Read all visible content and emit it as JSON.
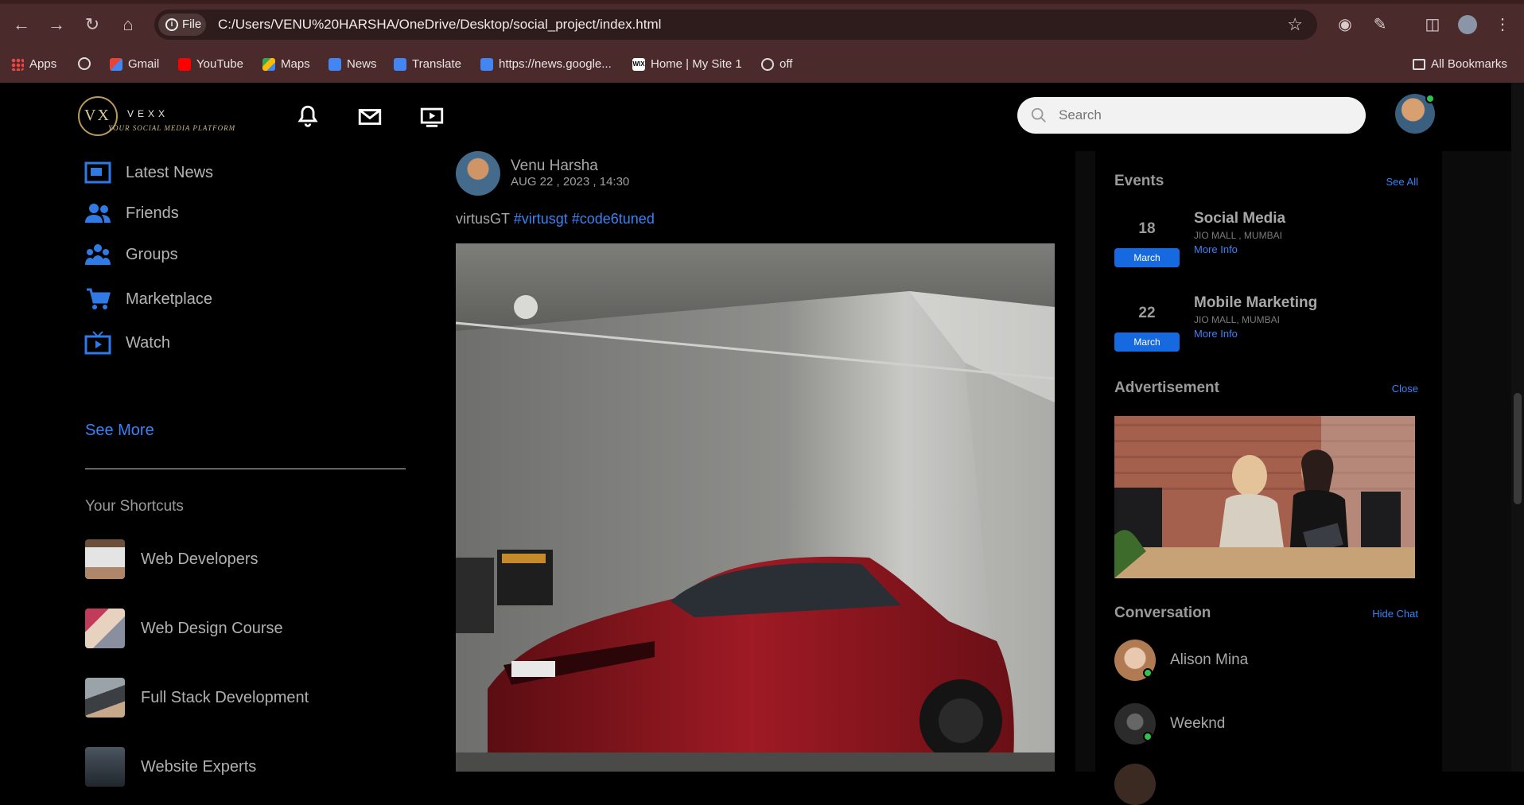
{
  "browser": {
    "file_chip": "File",
    "url": "C:/Users/VENU%20HARSHA/OneDrive/Desktop/social_project/index.html",
    "bookmarks": [
      {
        "label": "Apps",
        "icon": "apps-grid-icon"
      },
      {
        "label": "",
        "icon": "globe-icon"
      },
      {
        "label": "Gmail",
        "icon": "gmail-icon"
      },
      {
        "label": "YouTube",
        "icon": "youtube-icon"
      },
      {
        "label": "Maps",
        "icon": "maps-icon"
      },
      {
        "label": "News",
        "icon": "news-icon"
      },
      {
        "label": "Translate",
        "icon": "translate-icon"
      },
      {
        "label": "https://news.google...",
        "icon": "news-icon"
      },
      {
        "label": "Home | My Site 1",
        "icon": "wix-icon"
      },
      {
        "label": "off",
        "icon": "globe-icon"
      }
    ],
    "all_bookmarks": "All Bookmarks"
  },
  "header": {
    "logo_mark": "VX",
    "logo_name": "VEXX",
    "logo_tagline": "YOUR SOCIAL MEDIA PLATFORM",
    "search_placeholder": "Search"
  },
  "sidebar": {
    "items": [
      {
        "label": "Latest News",
        "icon": "news-icon"
      },
      {
        "label": "Friends",
        "icon": "friends-icon"
      },
      {
        "label": "Groups",
        "icon": "groups-icon"
      },
      {
        "label": "Marketplace",
        "icon": "cart-icon"
      },
      {
        "label": "Watch",
        "icon": "tv-icon"
      }
    ],
    "see_more": "See More",
    "shortcuts_title": "Your Shortcuts",
    "shortcuts": [
      {
        "label": "Web Developers"
      },
      {
        "label": "Web Design Course"
      },
      {
        "label": "Full Stack Development"
      },
      {
        "label": "Website Experts"
      }
    ]
  },
  "post": {
    "author": "Venu Harsha",
    "time": "AUG 22 , 2023 , 14:30",
    "text": "virtusGT",
    "tags": "#virtusgt #code6tuned"
  },
  "events": {
    "title": "Events",
    "see_all": "See All",
    "items": [
      {
        "day": "18",
        "month": "March",
        "name": "Social Media",
        "location": "JIO MALL , MUMBAI",
        "more": "More Info"
      },
      {
        "day": "22",
        "month": "March",
        "name": "Mobile Marketing",
        "location": "JIO MALL, MUMBAI",
        "more": "More Info"
      }
    ]
  },
  "advertisement": {
    "title": "Advertisement",
    "close": "Close"
  },
  "conversation": {
    "title": "Conversation",
    "hide": "Hide Chat",
    "contacts": [
      {
        "name": "Alison Mina"
      },
      {
        "name": "Weeknd"
      }
    ]
  },
  "colors": {
    "accent": "#3b82f6",
    "chrome": "#4a2a2a",
    "online": "#31c24d"
  }
}
